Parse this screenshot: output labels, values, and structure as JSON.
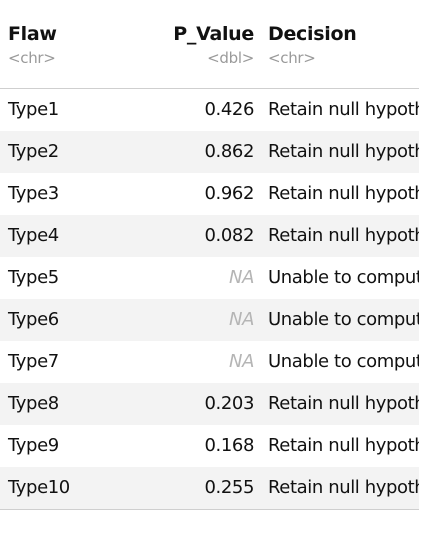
{
  "columns": [
    {
      "name": "Flaw",
      "type": "<chr>"
    },
    {
      "name": "P_Value",
      "type": "<dbl>"
    },
    {
      "name": "Decision",
      "type": "<chr>"
    }
  ],
  "rows": [
    {
      "flaw": "Type1",
      "p_value": "0.426",
      "decision": "Retain null hypothesis"
    },
    {
      "flaw": "Type2",
      "p_value": "0.862",
      "decision": "Retain null hypothesis"
    },
    {
      "flaw": "Type3",
      "p_value": "0.962",
      "decision": "Retain null hypothesis"
    },
    {
      "flaw": "Type4",
      "p_value": "0.082",
      "decision": "Retain null hypothesis"
    },
    {
      "flaw": "Type5",
      "p_value": "NA",
      "decision": "Unable to compute"
    },
    {
      "flaw": "Type6",
      "p_value": "NA",
      "decision": "Unable to compute"
    },
    {
      "flaw": "Type7",
      "p_value": "NA",
      "decision": "Unable to compute"
    },
    {
      "flaw": "Type8",
      "p_value": "0.203",
      "decision": "Retain null hypothesis"
    },
    {
      "flaw": "Type9",
      "p_value": "0.168",
      "decision": "Retain null hypothesis"
    },
    {
      "flaw": "Type10",
      "p_value": "0.255",
      "decision": "Retain null hypothesis"
    }
  ]
}
